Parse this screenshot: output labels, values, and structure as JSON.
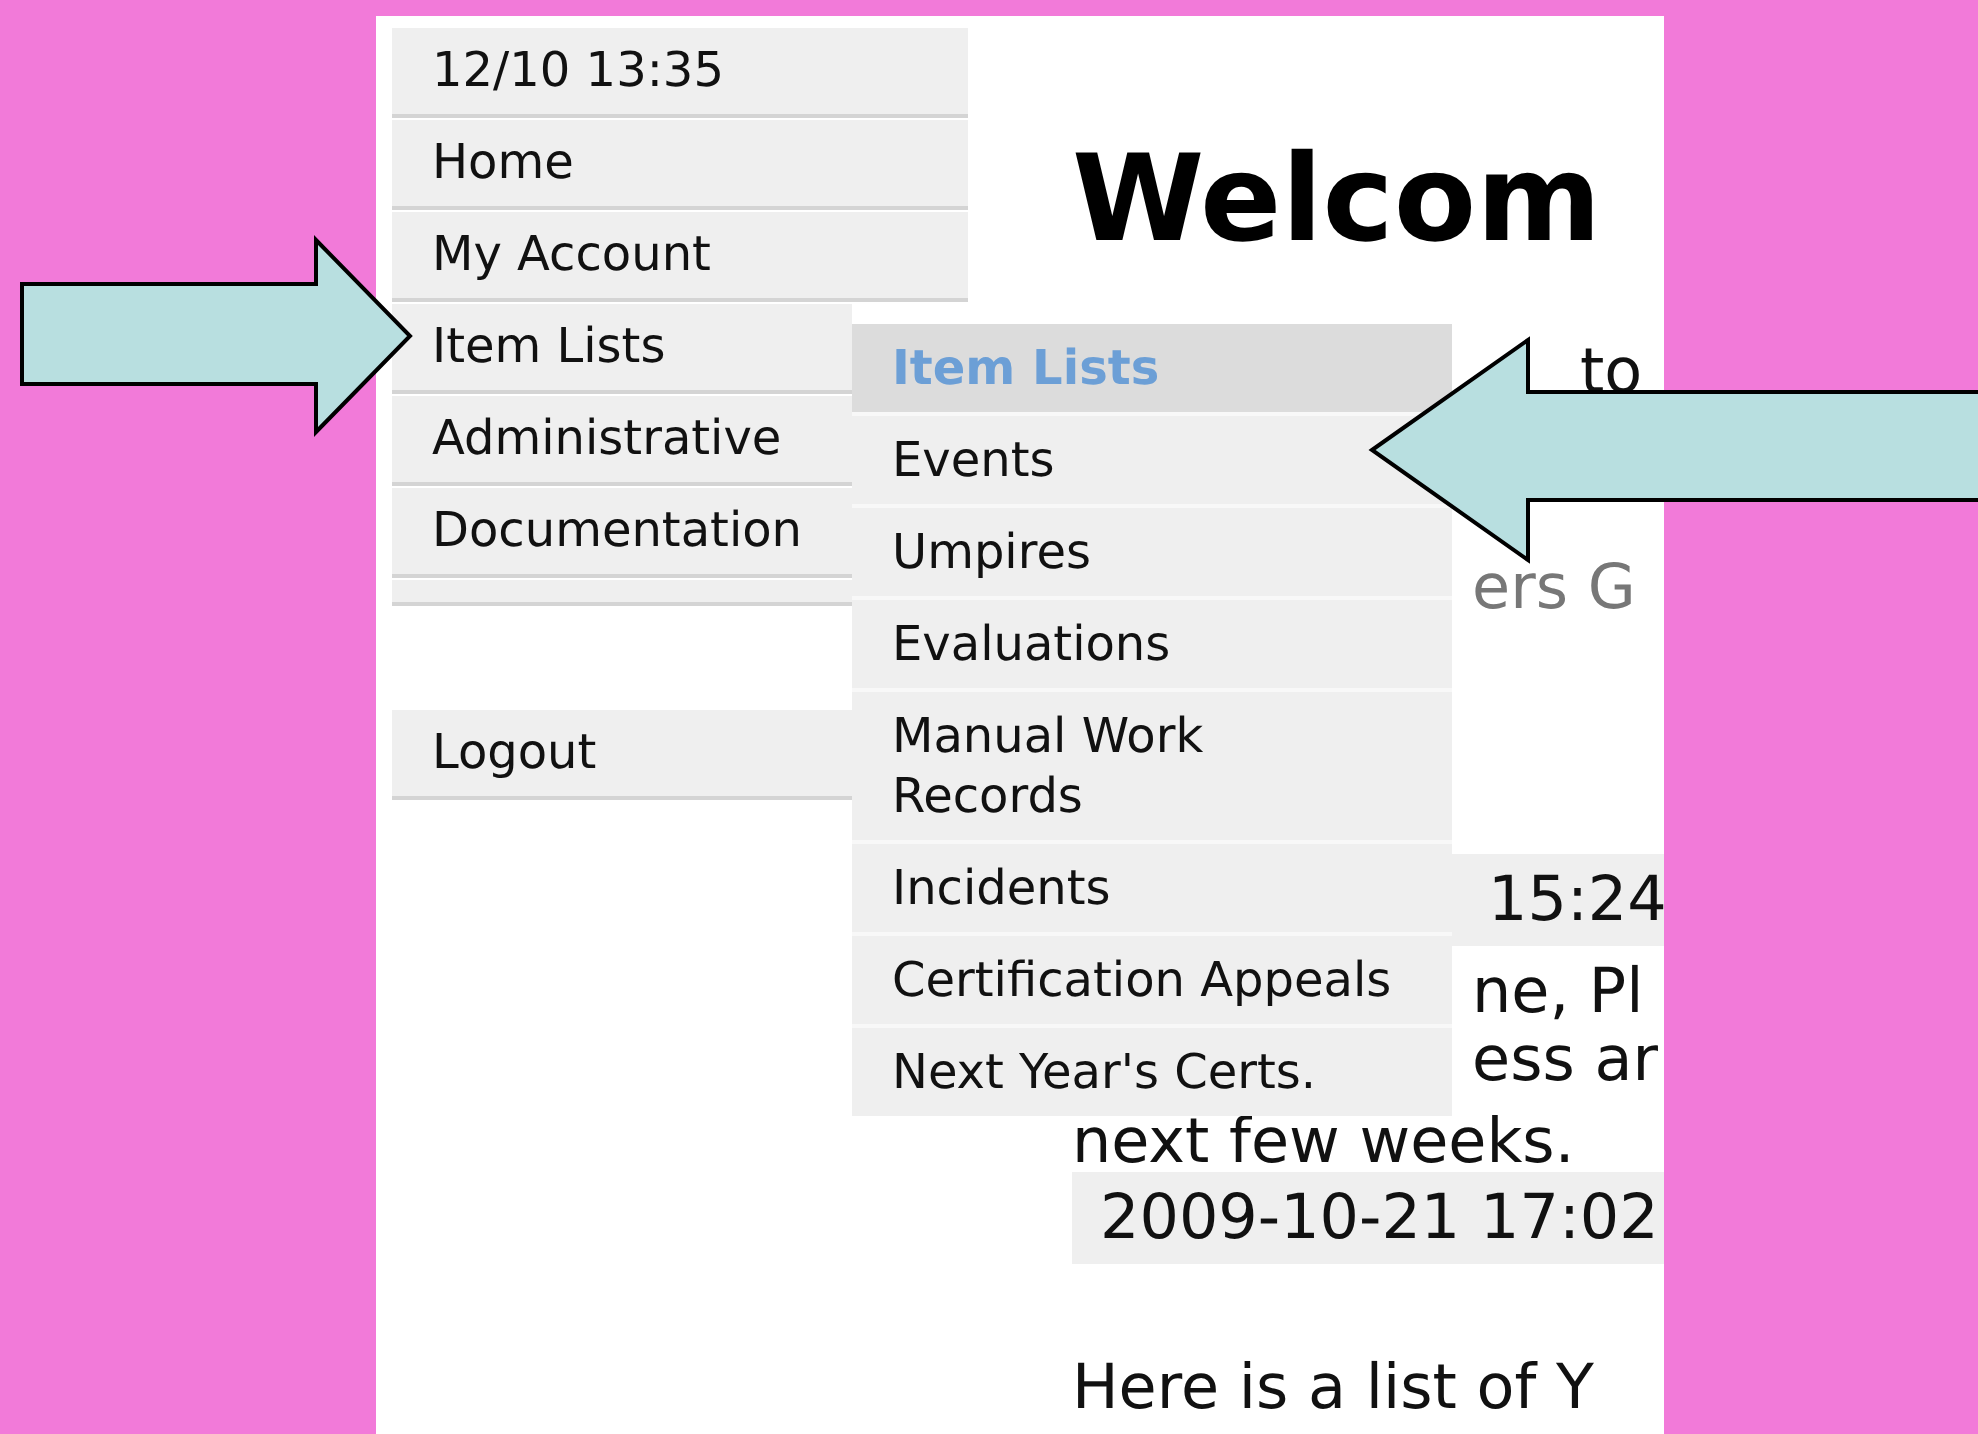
{
  "sidebar": {
    "clock": "12/10 13:35",
    "items": [
      {
        "label": "Home"
      },
      {
        "label": "My Account"
      },
      {
        "label": "Item Lists"
      },
      {
        "label": "Administrative"
      },
      {
        "label": "Documentation"
      }
    ],
    "logout": "Logout"
  },
  "dropdown": {
    "title": "Item Lists",
    "items": [
      {
        "label": "Events"
      },
      {
        "label": "Umpires"
      },
      {
        "label": "Evaluations"
      },
      {
        "label": "Manual Work Records"
      },
      {
        "label": "Incidents"
      },
      {
        "label": "Certification Appeals"
      },
      {
        "label": "Next Year's Certs."
      }
    ]
  },
  "content": {
    "heading": "Welcom",
    "fragments": [
      {
        "kind": "link",
        "text": "to",
        "covered": true
      },
      {
        "kind": "muted",
        "text": "ers G",
        "covered": true
      },
      {
        "kind": "stamp",
        "text": "15:24",
        "covered": true
      },
      {
        "kind": "text",
        "text": "ne, Pl",
        "covered": true
      },
      {
        "kind": "text",
        "text": "ess ar",
        "covered": true
      },
      {
        "kind": "text",
        "text": "next few weeks.",
        "covered": false
      },
      {
        "kind": "stamp",
        "text": "2009-10-21 17:02",
        "covered": false
      },
      {
        "kind": "lead",
        "text": "Here is a list of Y",
        "covered": false
      }
    ]
  }
}
